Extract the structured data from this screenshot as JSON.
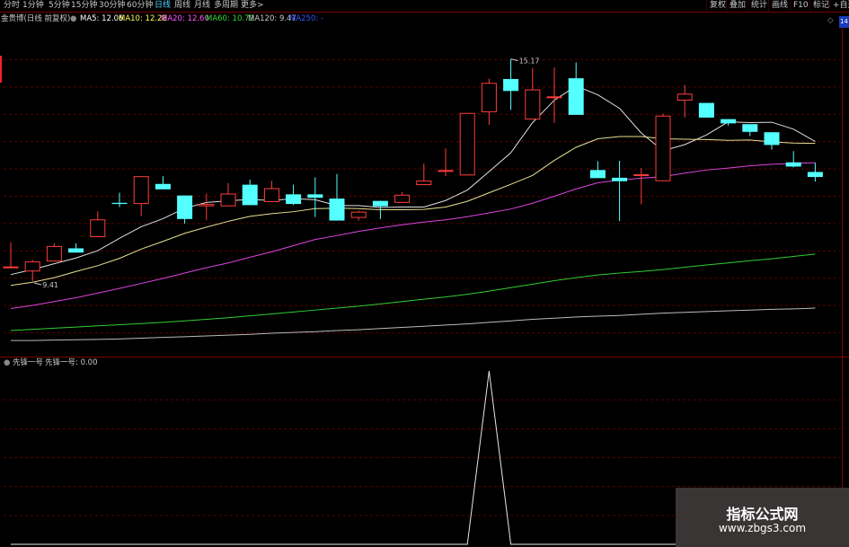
{
  "toolbar": {
    "periods": [
      {
        "label": "分时",
        "active": false
      },
      {
        "label": "1分钟",
        "active": false
      },
      {
        "label": "5分钟",
        "active": false
      },
      {
        "label": "15分钟",
        "active": false
      },
      {
        "label": "30分钟",
        "active": false
      },
      {
        "label": "60分钟",
        "active": false
      },
      {
        "label": "日线",
        "active": true
      },
      {
        "label": "周线",
        "active": false
      },
      {
        "label": "月线",
        "active": false
      },
      {
        "label": "多周期",
        "active": false
      },
      {
        "label": "更多>",
        "active": false
      }
    ],
    "right_buttons": [
      "复权",
      "叠加",
      "统计",
      "画线",
      "F10",
      "标记",
      "+自选"
    ]
  },
  "ma_legend": {
    "title": "金贵博(日线 前复权)",
    "items": [
      {
        "label": "MA5: 12.06",
        "color": "#ffffff"
      },
      {
        "label": "MA10: 12.28",
        "color": "#ffff55"
      },
      {
        "label": "MA20: 12.60",
        "color": "#ff55ff"
      },
      {
        "label": "MA60: 10.72",
        "color": "#33dd33"
      },
      {
        "label": "MA120: 9.47",
        "color": "#c8c8c8"
      },
      {
        "label": "MA250: -",
        "color": "#3355ff"
      }
    ],
    "badge": "14"
  },
  "price_chart": {
    "high_label": "15.17",
    "low_label": "9.41",
    "colors": {
      "up": "#ff3c3c",
      "down": "#54ffff",
      "grid": "#5a0000"
    }
  },
  "indicator": {
    "title": "先锋一号",
    "value_label": "先锋一号: 0.00"
  },
  "chart_data": {
    "type": "candlestick",
    "candles": [
      {
        "o": 9.79,
        "h": 10.42,
        "l": 9.79,
        "c": 9.79
      },
      {
        "o": 9.66,
        "h": 9.96,
        "l": 9.41,
        "c": 9.92
      },
      {
        "o": 9.92,
        "h": 10.39,
        "l": 9.92,
        "c": 10.32
      },
      {
        "o": 10.26,
        "h": 10.39,
        "l": 10.15,
        "c": 10.15
      },
      {
        "o": 10.55,
        "h": 11.22,
        "l": 10.55,
        "c": 11.01
      },
      {
        "o": 11.44,
        "h": 11.7,
        "l": 11.33,
        "c": 11.41
      },
      {
        "o": 11.41,
        "h": 12.13,
        "l": 11.1,
        "c": 12.13
      },
      {
        "o": 11.93,
        "h": 12.13,
        "l": 11.79,
        "c": 11.79
      },
      {
        "o": 11.63,
        "h": 11.63,
        "l": 10.9,
        "c": 11.02
      },
      {
        "o": 11.35,
        "h": 11.68,
        "l": 10.99,
        "c": 11.41
      },
      {
        "o": 11.35,
        "h": 11.95,
        "l": 11.35,
        "c": 11.68
      },
      {
        "o": 11.91,
        "h": 12.04,
        "l": 11.38,
        "c": 11.38
      },
      {
        "o": 11.46,
        "h": 12.01,
        "l": 11.46,
        "c": 11.82
      },
      {
        "o": 11.66,
        "h": 11.91,
        "l": 11.38,
        "c": 11.41
      },
      {
        "o": 11.66,
        "h": 12.1,
        "l": 11.07,
        "c": 11.57
      },
      {
        "o": 11.55,
        "h": 12.19,
        "l": 10.98,
        "c": 10.98
      },
      {
        "o": 11.05,
        "h": 11.24,
        "l": 10.98,
        "c": 11.21
      },
      {
        "o": 11.49,
        "h": 11.49,
        "l": 11.02,
        "c": 11.35
      },
      {
        "o": 11.44,
        "h": 11.72,
        "l": 11.44,
        "c": 11.65
      },
      {
        "o": 11.9,
        "h": 12.46,
        "l": 11.9,
        "c": 12.02
      },
      {
        "o": 12.29,
        "h": 12.85,
        "l": 12.13,
        "c": 12.29
      },
      {
        "o": 12.15,
        "h": 13.77,
        "l": 12.15,
        "c": 13.77
      },
      {
        "o": 13.79,
        "h": 14.66,
        "l": 13.46,
        "c": 14.55
      },
      {
        "o": 14.65,
        "h": 15.17,
        "l": 13.85,
        "c": 14.34
      },
      {
        "o": 13.6,
        "h": 14.94,
        "l": 13.6,
        "c": 14.38
      },
      {
        "o": 14.2,
        "h": 14.95,
        "l": 13.51,
        "c": 14.2
      },
      {
        "o": 14.67,
        "h": 15.08,
        "l": 13.83,
        "c": 13.72
      },
      {
        "o": 12.29,
        "h": 12.52,
        "l": 12.12,
        "c": 12.08
      },
      {
        "o": 12.09,
        "h": 12.53,
        "l": 10.97,
        "c": 12.0
      },
      {
        "o": 12.18,
        "h": 12.34,
        "l": 11.4,
        "c": 12.18
      },
      {
        "o": 12.0,
        "h": 13.75,
        "l": 12.0,
        "c": 13.7
      },
      {
        "o": 14.09,
        "h": 14.5,
        "l": 13.65,
        "c": 14.27
      },
      {
        "o": 14.03,
        "h": 14.03,
        "l": 13.65,
        "c": 13.65
      },
      {
        "o": 13.61,
        "h": 13.61,
        "l": 13.44,
        "c": 13.5
      },
      {
        "o": 13.48,
        "h": 13.48,
        "l": 13.17,
        "c": 13.28
      },
      {
        "o": 13.27,
        "h": 13.27,
        "l": 12.82,
        "c": 12.94
      },
      {
        "o": 12.49,
        "h": 12.78,
        "l": 12.36,
        "c": 12.38
      },
      {
        "o": 12.24,
        "h": 12.48,
        "l": 11.99,
        "c": 12.11
      }
    ],
    "ma_series": [
      {
        "name": "MA5",
        "color": "#e0e0e0",
        "values": [
          9.58,
          9.71,
          9.86,
          10.01,
          10.2,
          10.52,
          10.82,
          11.03,
          11.3,
          11.45,
          11.49,
          11.53,
          11.5,
          11.55,
          11.52,
          11.37,
          11.37,
          11.32,
          11.33,
          11.33,
          11.5,
          11.77,
          12.25,
          12.74,
          13.52,
          14.1,
          14.47,
          14.24,
          13.89,
          13.25,
          12.79,
          12.95,
          13.2,
          13.54,
          13.52,
          13.53,
          13.35,
          13.03
        ]
      },
      {
        "name": "MA10",
        "color": "#e8e090",
        "values": [
          9.3,
          9.38,
          9.5,
          9.66,
          9.81,
          10.0,
          10.24,
          10.44,
          10.65,
          10.81,
          10.96,
          11.09,
          11.16,
          11.21,
          11.29,
          11.3,
          11.29,
          11.26,
          11.26,
          11.27,
          11.33,
          11.48,
          11.7,
          11.92,
          12.15,
          12.54,
          12.88,
          13.1,
          13.16,
          13.16,
          13.1,
          13.09,
          13.08,
          13.06,
          13.07,
          13.02,
          12.99,
          12.98
        ]
      },
      {
        "name": "MA20",
        "color": "#dd44dd",
        "values": [
          8.7,
          8.78,
          8.88,
          8.98,
          9.1,
          9.22,
          9.35,
          9.48,
          9.62,
          9.76,
          9.88,
          10.03,
          10.17,
          10.33,
          10.49,
          10.59,
          10.7,
          10.79,
          10.87,
          10.94,
          11.0,
          11.08,
          11.18,
          11.28,
          11.43,
          11.61,
          11.8,
          11.96,
          12.03,
          12.08,
          12.12,
          12.21,
          12.29,
          12.34,
          12.4,
          12.44,
          12.46,
          12.48
        ]
      },
      {
        "name": "MA60",
        "color": "#33cc33",
        "values": [
          8.13,
          8.16,
          8.19,
          8.22,
          8.25,
          8.28,
          8.31,
          8.34,
          8.38,
          8.42,
          8.46,
          8.51,
          8.56,
          8.61,
          8.66,
          8.71,
          8.76,
          8.82,
          8.88,
          8.94,
          9.0,
          9.07,
          9.15,
          9.24,
          9.33,
          9.42,
          9.5,
          9.57,
          9.62,
          9.66,
          9.71,
          9.77,
          9.83,
          9.88,
          9.94,
          9.99,
          10.05,
          10.11
        ]
      },
      {
        "name": "MA120",
        "color": "#bbbbbb",
        "values": [
          7.87,
          7.87,
          7.88,
          7.89,
          7.9,
          7.91,
          7.93,
          7.95,
          7.97,
          7.99,
          8.01,
          8.03,
          8.06,
          8.08,
          8.1,
          8.13,
          8.15,
          8.18,
          8.21,
          8.24,
          8.27,
          8.3,
          8.34,
          8.38,
          8.42,
          8.45,
          8.48,
          8.5,
          8.52,
          8.55,
          8.58,
          8.6,
          8.62,
          8.64,
          8.66,
          8.68,
          8.69,
          8.71
        ]
      }
    ],
    "price_range": [
      7.5,
      16.0
    ],
    "indicator_values": [
      0,
      0,
      0,
      0,
      0,
      0,
      0,
      0,
      0,
      0,
      0,
      0,
      0,
      0,
      0,
      0,
      0,
      0,
      0,
      0,
      0,
      0,
      1,
      0,
      0,
      0,
      0,
      0,
      0,
      0,
      0,
      0,
      0,
      0,
      0,
      0,
      0,
      0
    ],
    "indicator_range": [
      0,
      1.0
    ]
  },
  "watermark": {
    "title": "指标公式网",
    "url": "www.zbgs3.com"
  }
}
